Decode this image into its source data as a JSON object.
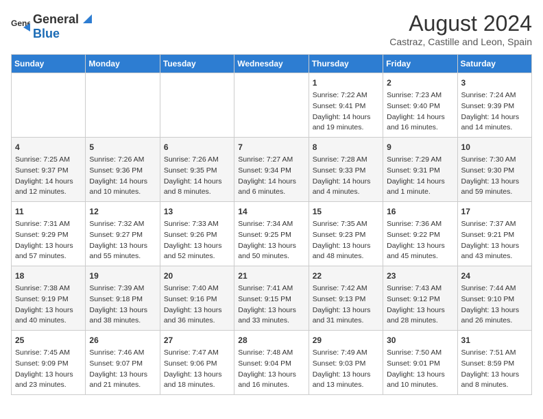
{
  "header": {
    "logo_general": "General",
    "logo_blue": "Blue",
    "month_year": "August 2024",
    "location": "Castraz, Castille and Leon, Spain"
  },
  "days_of_week": [
    "Sunday",
    "Monday",
    "Tuesday",
    "Wednesday",
    "Thursday",
    "Friday",
    "Saturday"
  ],
  "weeks": [
    [
      {
        "day": "",
        "info": ""
      },
      {
        "day": "",
        "info": ""
      },
      {
        "day": "",
        "info": ""
      },
      {
        "day": "",
        "info": ""
      },
      {
        "day": "1",
        "info": "Sunrise: 7:22 AM\nSunset: 9:41 PM\nDaylight: 14 hours\nand 19 minutes."
      },
      {
        "day": "2",
        "info": "Sunrise: 7:23 AM\nSunset: 9:40 PM\nDaylight: 14 hours\nand 16 minutes."
      },
      {
        "day": "3",
        "info": "Sunrise: 7:24 AM\nSunset: 9:39 PM\nDaylight: 14 hours\nand 14 minutes."
      }
    ],
    [
      {
        "day": "4",
        "info": "Sunrise: 7:25 AM\nSunset: 9:37 PM\nDaylight: 14 hours\nand 12 minutes."
      },
      {
        "day": "5",
        "info": "Sunrise: 7:26 AM\nSunset: 9:36 PM\nDaylight: 14 hours\nand 10 minutes."
      },
      {
        "day": "6",
        "info": "Sunrise: 7:26 AM\nSunset: 9:35 PM\nDaylight: 14 hours\nand 8 minutes."
      },
      {
        "day": "7",
        "info": "Sunrise: 7:27 AM\nSunset: 9:34 PM\nDaylight: 14 hours\nand 6 minutes."
      },
      {
        "day": "8",
        "info": "Sunrise: 7:28 AM\nSunset: 9:33 PM\nDaylight: 14 hours\nand 4 minutes."
      },
      {
        "day": "9",
        "info": "Sunrise: 7:29 AM\nSunset: 9:31 PM\nDaylight: 14 hours\nand 1 minute."
      },
      {
        "day": "10",
        "info": "Sunrise: 7:30 AM\nSunset: 9:30 PM\nDaylight: 13 hours\nand 59 minutes."
      }
    ],
    [
      {
        "day": "11",
        "info": "Sunrise: 7:31 AM\nSunset: 9:29 PM\nDaylight: 13 hours\nand 57 minutes."
      },
      {
        "day": "12",
        "info": "Sunrise: 7:32 AM\nSunset: 9:27 PM\nDaylight: 13 hours\nand 55 minutes."
      },
      {
        "day": "13",
        "info": "Sunrise: 7:33 AM\nSunset: 9:26 PM\nDaylight: 13 hours\nand 52 minutes."
      },
      {
        "day": "14",
        "info": "Sunrise: 7:34 AM\nSunset: 9:25 PM\nDaylight: 13 hours\nand 50 minutes."
      },
      {
        "day": "15",
        "info": "Sunrise: 7:35 AM\nSunset: 9:23 PM\nDaylight: 13 hours\nand 48 minutes."
      },
      {
        "day": "16",
        "info": "Sunrise: 7:36 AM\nSunset: 9:22 PM\nDaylight: 13 hours\nand 45 minutes."
      },
      {
        "day": "17",
        "info": "Sunrise: 7:37 AM\nSunset: 9:21 PM\nDaylight: 13 hours\nand 43 minutes."
      }
    ],
    [
      {
        "day": "18",
        "info": "Sunrise: 7:38 AM\nSunset: 9:19 PM\nDaylight: 13 hours\nand 40 minutes."
      },
      {
        "day": "19",
        "info": "Sunrise: 7:39 AM\nSunset: 9:18 PM\nDaylight: 13 hours\nand 38 minutes."
      },
      {
        "day": "20",
        "info": "Sunrise: 7:40 AM\nSunset: 9:16 PM\nDaylight: 13 hours\nand 36 minutes."
      },
      {
        "day": "21",
        "info": "Sunrise: 7:41 AM\nSunset: 9:15 PM\nDaylight: 13 hours\nand 33 minutes."
      },
      {
        "day": "22",
        "info": "Sunrise: 7:42 AM\nSunset: 9:13 PM\nDaylight: 13 hours\nand 31 minutes."
      },
      {
        "day": "23",
        "info": "Sunrise: 7:43 AM\nSunset: 9:12 PM\nDaylight: 13 hours\nand 28 minutes."
      },
      {
        "day": "24",
        "info": "Sunrise: 7:44 AM\nSunset: 9:10 PM\nDaylight: 13 hours\nand 26 minutes."
      }
    ],
    [
      {
        "day": "25",
        "info": "Sunrise: 7:45 AM\nSunset: 9:09 PM\nDaylight: 13 hours\nand 23 minutes."
      },
      {
        "day": "26",
        "info": "Sunrise: 7:46 AM\nSunset: 9:07 PM\nDaylight: 13 hours\nand 21 minutes."
      },
      {
        "day": "27",
        "info": "Sunrise: 7:47 AM\nSunset: 9:06 PM\nDaylight: 13 hours\nand 18 minutes."
      },
      {
        "day": "28",
        "info": "Sunrise: 7:48 AM\nSunset: 9:04 PM\nDaylight: 13 hours\nand 16 minutes."
      },
      {
        "day": "29",
        "info": "Sunrise: 7:49 AM\nSunset: 9:03 PM\nDaylight: 13 hours\nand 13 minutes."
      },
      {
        "day": "30",
        "info": "Sunrise: 7:50 AM\nSunset: 9:01 PM\nDaylight: 13 hours\nand 10 minutes."
      },
      {
        "day": "31",
        "info": "Sunrise: 7:51 AM\nSunset: 8:59 PM\nDaylight: 13 hours\nand 8 minutes."
      }
    ]
  ]
}
